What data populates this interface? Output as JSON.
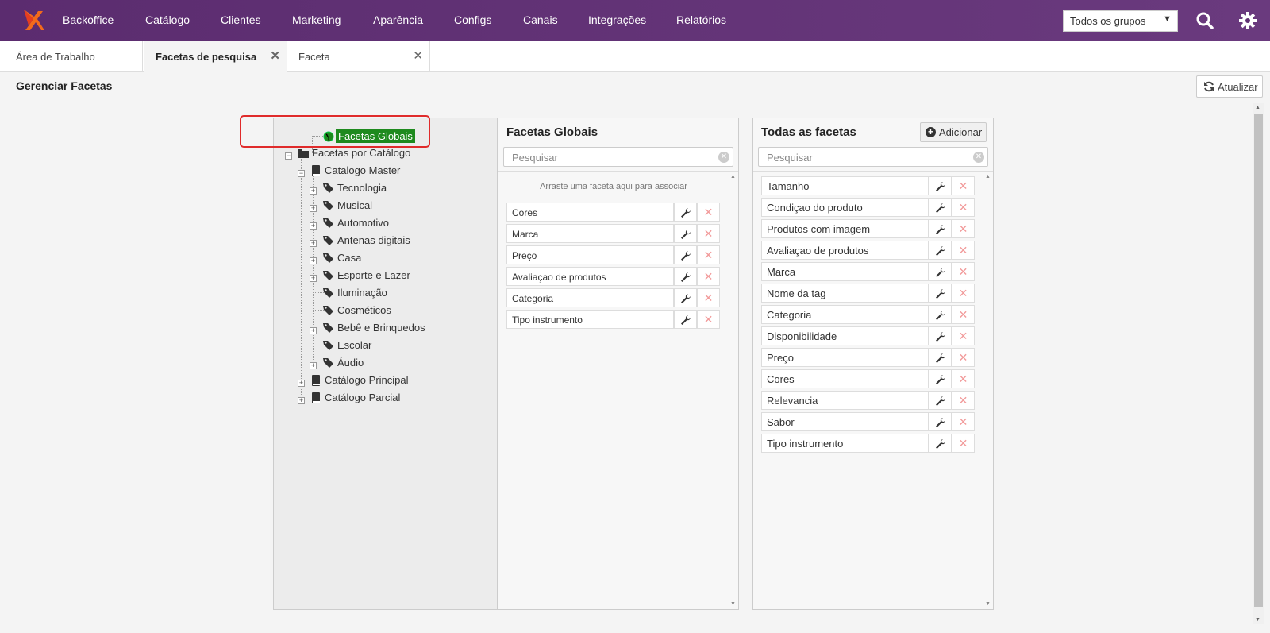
{
  "nav": {
    "items": [
      "Backoffice",
      "Catálogo",
      "Clientes",
      "Marketing",
      "Aparência",
      "Configs",
      "Canais",
      "Integrações",
      "Relatórios"
    ],
    "group_select": "Todos os grupos",
    "logo_icon": "logo-icon",
    "search_icon": "search-icon",
    "settings_icon": "gear-icon"
  },
  "tabs": [
    {
      "label": "Área de Trabalho",
      "active": false,
      "closable": false
    },
    {
      "label": "Facetas de pesquisa",
      "active": true,
      "closable": true
    },
    {
      "label": "Faceta",
      "active": false,
      "closable": true
    }
  ],
  "page": {
    "title": "Gerenciar Facetas",
    "refresh_label": "Atualizar"
  },
  "tree": {
    "root_selected": "Facetas Globais",
    "root_catalog": "Facetas por Catálogo",
    "catalog_master": "Catalogo Master",
    "categories": [
      "Tecnologia",
      "Musical",
      "Automotivo",
      "Antenas digitais",
      "Casa",
      "Esporte e Lazer",
      "Iluminação",
      "Cosméticos",
      "Bebê e Brinquedos",
      "Escolar",
      "Áudio"
    ],
    "other_catalogs": [
      "Catálogo Principal",
      "Catálogo Parcial"
    ]
  },
  "global_facets": {
    "title": "Facetas Globais",
    "search_placeholder": "Pesquisar",
    "hint": "Arraste uma faceta aqui para associar",
    "items": [
      "Cores",
      "Marca",
      "Preço",
      "Avaliaçao de produtos",
      "Categoria",
      "Tipo instrumento"
    ]
  },
  "all_facets": {
    "title": "Todas as facetas",
    "add_label": "Adicionar",
    "search_placeholder": "Pesquisar",
    "items": [
      "Tamanho",
      "Condiçao do produto",
      "Produtos com imagem",
      "Avaliaçao de produtos",
      "Marca",
      "Nome da tag",
      "Categoria",
      "Disponibilidade",
      "Preço",
      "Cores",
      "Relevancia",
      "Sabor",
      "Tipo instrumento"
    ]
  },
  "colors": {
    "nav_bg": "#5b2c6f",
    "selected_node": "#1e8a1e",
    "highlight": "#e02b2b",
    "delete_icon": "#f29a9a"
  }
}
